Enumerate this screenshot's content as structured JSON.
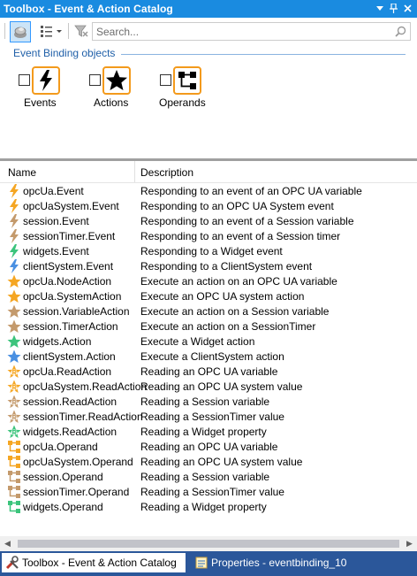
{
  "window": {
    "title": "Toolbox - Event & Action Catalog"
  },
  "titlebar_controls": [
    {
      "icon": "dropdown-arrow-icon",
      "glyph": "▼"
    },
    {
      "icon": "pin-icon",
      "glyph": "📌"
    },
    {
      "icon": "close-icon",
      "glyph": "✕"
    }
  ],
  "search": {
    "placeholder": "Search..."
  },
  "group": {
    "title": "Event Binding objects",
    "tiles": [
      {
        "label": "Events",
        "icon": "lightning-icon",
        "checked": false
      },
      {
        "label": "Actions",
        "icon": "star-icon",
        "checked": false
      },
      {
        "label": "Operands",
        "icon": "operand-tree-icon",
        "checked": false
      }
    ]
  },
  "table": {
    "columns": [
      "Name",
      "Description"
    ],
    "rows": [
      {
        "name": "opcUa.Event",
        "description": "Responding to an event of an OPC UA variable",
        "kind": "event",
        "color": "#f5a623"
      },
      {
        "name": "opcUaSystem.Event",
        "description": "Responding to an OPC UA System event",
        "kind": "event",
        "color": "#f5a623"
      },
      {
        "name": "session.Event",
        "description": "Responding to an event of a Session variable",
        "kind": "event",
        "color": "#c49a6c"
      },
      {
        "name": "sessionTimer.Event",
        "description": "Responding to an event of a Session timer",
        "kind": "event",
        "color": "#c49a6c"
      },
      {
        "name": "widgets.Event",
        "description": "Responding to a Widget event",
        "kind": "event",
        "color": "#3cc47c"
      },
      {
        "name": "clientSystem.Event",
        "description": "Responding to a ClientSystem event",
        "kind": "event",
        "color": "#4a90e2"
      },
      {
        "name": "opcUa.NodeAction",
        "description": "Execute an action on an OPC UA variable",
        "kind": "action",
        "color": "#f5a623"
      },
      {
        "name": "opcUa.SystemAction",
        "description": "Execute an OPC UA system action",
        "kind": "action",
        "color": "#f5a623"
      },
      {
        "name": "session.VariableAction",
        "description": "Execute an action on a Session variable",
        "kind": "action",
        "color": "#c49a6c"
      },
      {
        "name": "session.TimerAction",
        "description": "Execute an action on a SessionTimer",
        "kind": "action",
        "color": "#c49a6c"
      },
      {
        "name": "widgets.Action",
        "description": "Execute a Widget action",
        "kind": "action",
        "color": "#3cc47c"
      },
      {
        "name": "clientSystem.Action",
        "description": "Execute a ClientSystem action",
        "kind": "action",
        "color": "#4a90e2"
      },
      {
        "name": "opcUa.ReadAction",
        "description": "Reading an OPC UA variable",
        "kind": "read",
        "color": "#f5a623"
      },
      {
        "name": "opcUaSystem.ReadAction",
        "description": "Reading an OPC UA system value",
        "kind": "read",
        "color": "#f5a623"
      },
      {
        "name": "session.ReadAction",
        "description": "Reading a Session variable",
        "kind": "read",
        "color": "#c49a6c"
      },
      {
        "name": "sessionTimer.ReadAction",
        "description": "Reading a SessionTimer value",
        "kind": "read",
        "color": "#c49a6c"
      },
      {
        "name": "widgets.ReadAction",
        "description": "Reading a Widget property",
        "kind": "read",
        "color": "#3cc47c"
      },
      {
        "name": "opcUa.Operand",
        "description": "Reading an OPC UA variable",
        "kind": "operand",
        "color": "#f5a623"
      },
      {
        "name": "opcUaSystem.Operand",
        "description": "Reading an OPC UA system value",
        "kind": "operand",
        "color": "#f5a623"
      },
      {
        "name": "session.Operand",
        "description": "Reading a Session variable",
        "kind": "operand",
        "color": "#c49a6c"
      },
      {
        "name": "sessionTimer.Operand",
        "description": "Reading a SessionTimer value",
        "kind": "operand",
        "color": "#c49a6c"
      },
      {
        "name": "widgets.Operand",
        "description": "Reading a Widget property",
        "kind": "operand",
        "color": "#3cc47c"
      }
    ]
  },
  "tabs": [
    {
      "label": "Toolbox - Event & Action Catalog",
      "active": true
    },
    {
      "label": "Properties - eventbinding_10",
      "active": false
    }
  ]
}
